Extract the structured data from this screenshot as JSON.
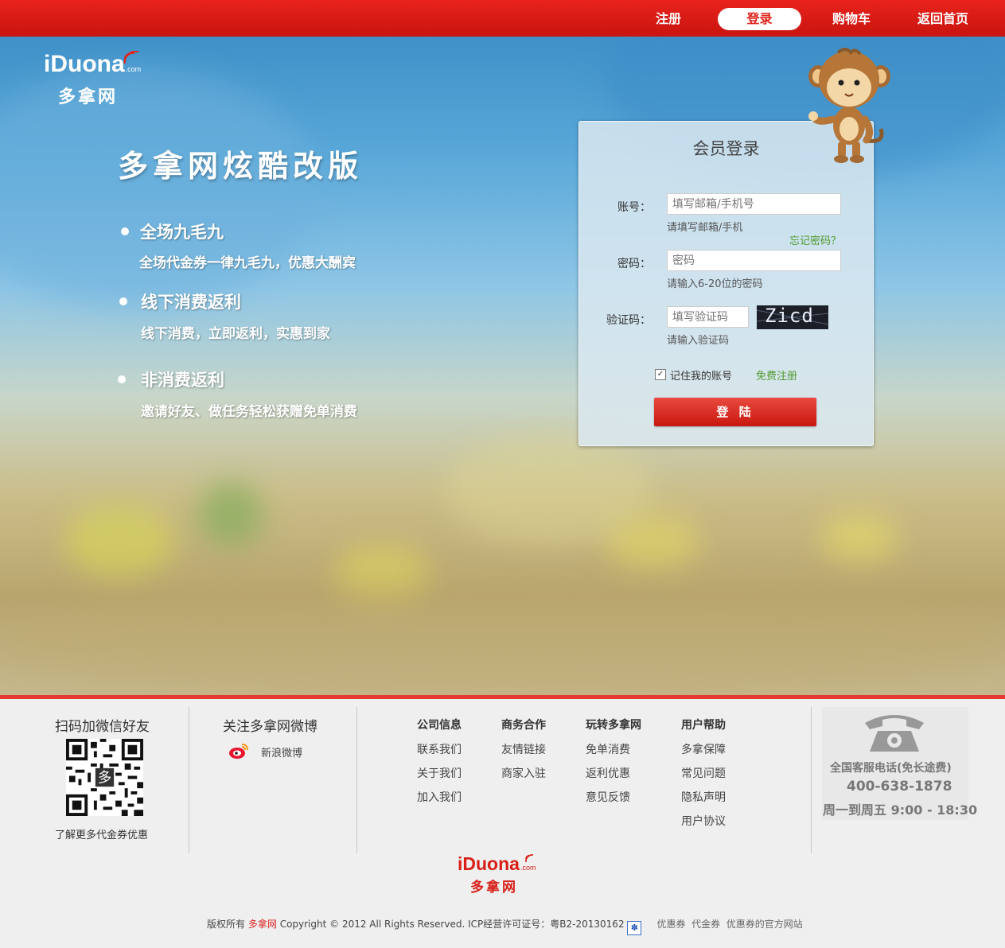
{
  "nav": {
    "register": "注册",
    "login": "登录",
    "cart": "购物车",
    "home": "返回首页"
  },
  "logo": {
    "brand": "iDuona",
    "domain": ".com",
    "cn": "多拿网"
  },
  "hero": {
    "headline": "多拿网炫酷改版",
    "features": [
      {
        "title": "全场九毛九",
        "desc": "全场代金券一律九毛九，优惠大酬宾"
      },
      {
        "title": "线下消费返利",
        "desc": "线下消费，立即返利，实惠到家"
      },
      {
        "title": "非消费返利",
        "desc": "邀请好友、做任务轻松获赠免单消费"
      }
    ]
  },
  "login": {
    "title": "会员登录",
    "account_label": "账号：",
    "account_placeholder": "填写邮箱/手机号",
    "account_hint": "请填写邮箱/手机",
    "forgot": "忘记密码？",
    "password_label": "密码：",
    "password_placeholder": "密码",
    "password_hint": "请输入6-20位的密码",
    "captcha_label": "验证码：",
    "captcha_placeholder": "填写验证码",
    "captcha_hint": "请输入验证码",
    "captcha_text": "Zicd",
    "remember": "记住我的账号",
    "remember_checked": true,
    "free_register": "免费注册",
    "submit": "登 陆"
  },
  "footer": {
    "wechat_title": "扫码加微信好友",
    "wechat_caption": "了解更多代金券优惠",
    "weibo_title": "关注多拿网微博",
    "weibo_link": "新浪微博",
    "columns": [
      {
        "head": "公司信息",
        "links": [
          "联系我们",
          "关于我们",
          "加入我们"
        ]
      },
      {
        "head": "商务合作",
        "links": [
          "友情链接",
          "商家入驻"
        ]
      },
      {
        "head": "玩转多拿网",
        "links": [
          "免单消费",
          "返利优惠",
          "意见反馈"
        ]
      },
      {
        "head": "用户帮助",
        "links": [
          "多拿保障",
          "常见问题",
          "隐私声明",
          "用户协议"
        ]
      }
    ],
    "phone_title": "全国客服电话(免长途费)",
    "phone_number": "400-638-1878",
    "phone_hours": "周一到周五 9:00 - 18:30",
    "copyright_prefix": "版权所有",
    "copyright_brand": "多拿网",
    "copyright_text": "Copyright © 2012 All Rights Reserved. ICP经营许可证号：粤B2-20130162",
    "extra_links": [
      "优惠券",
      "代金券",
      "优惠券的官方网站"
    ]
  },
  "colors": {
    "brand_red": "#e0231b",
    "green_link": "#4f9a2d"
  }
}
